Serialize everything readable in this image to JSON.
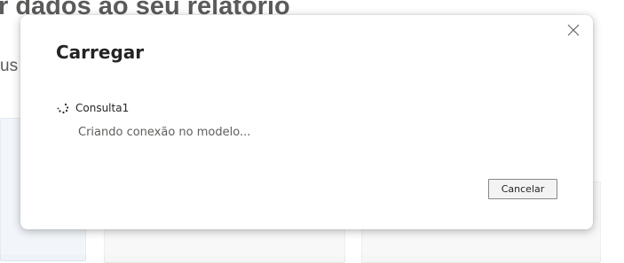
{
  "background": {
    "heading": "r dados ao seu relatório",
    "subtext": "us"
  },
  "dialog": {
    "title": "Carregar",
    "query_name": "Consulta1",
    "status": "Criando conexão no modelo...",
    "cancel_label": "Cancelar",
    "icons": {
      "close": "close-icon",
      "spinner": "loading-spinner-icon"
    }
  },
  "colors": {
    "text_primary": "#252423",
    "text_secondary": "#605e5c",
    "button_border": "#8a8886"
  }
}
